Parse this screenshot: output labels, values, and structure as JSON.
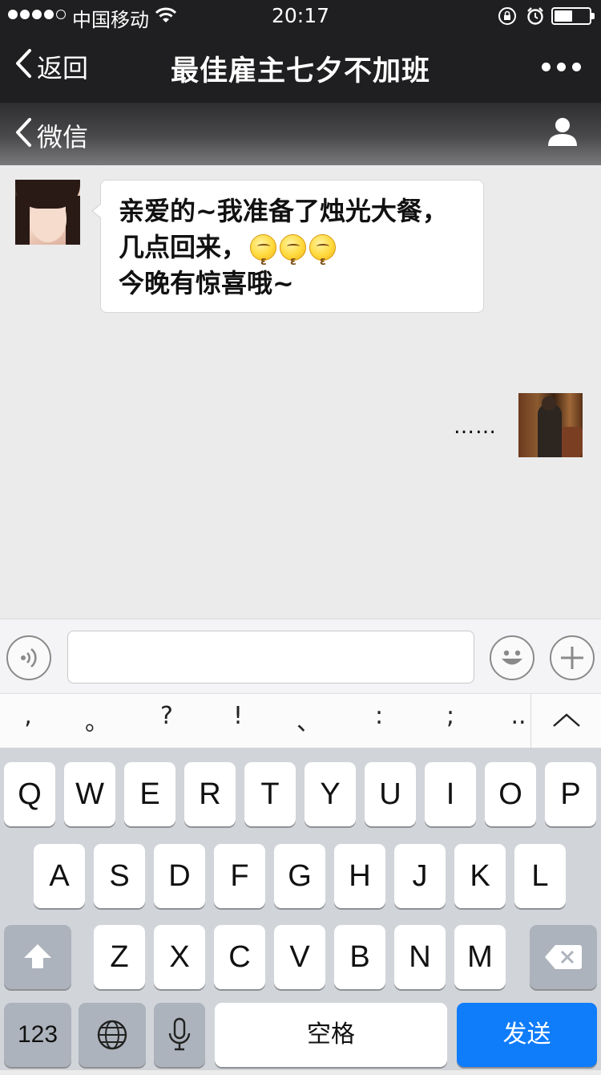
{
  "status_bar": {
    "carrier": "中国移动",
    "time": "20:17"
  },
  "nav": {
    "back_label": "返回",
    "title": "最佳雇主七夕不加班"
  },
  "sub_header": {
    "back_label": "微信"
  },
  "messages": {
    "incoming": {
      "line1": "亲爱的~我准备了烛光大餐，",
      "line2": "几点回来，",
      "line3": "今晚有惊喜哦~",
      "emoji": "kiss-face-icon"
    },
    "outgoing": {
      "text": "……"
    }
  },
  "input": {
    "placeholder": ""
  },
  "punctuation": {
    "keys": [
      ",",
      "。",
      "?",
      "!",
      "、",
      ":",
      ";",
      ".."
    ]
  },
  "keyboard": {
    "row1": [
      "Q",
      "W",
      "E",
      "R",
      "T",
      "Y",
      "U",
      "I",
      "O",
      "P"
    ],
    "row2": [
      "A",
      "S",
      "D",
      "F",
      "G",
      "H",
      "J",
      "K",
      "L"
    ],
    "row3": [
      "Z",
      "X",
      "C",
      "V",
      "B",
      "N",
      "M"
    ],
    "numbers_label": "123",
    "space_label": "空格",
    "send_label": "发送",
    "send_color": "#0f7cf9"
  }
}
